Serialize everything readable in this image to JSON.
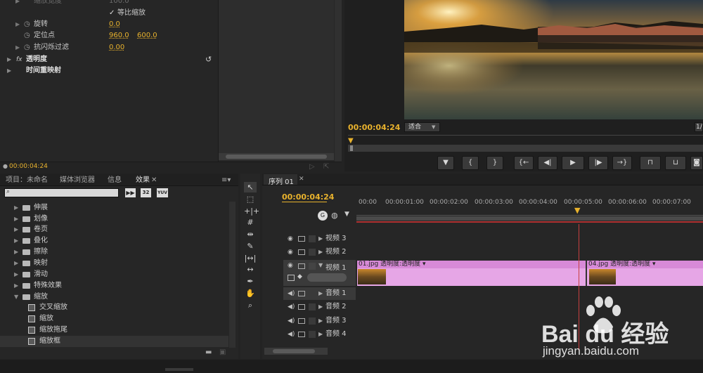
{
  "effect_controls": {
    "rows": [
      {
        "label": "缩放宽度",
        "value": "100.0"
      },
      {
        "label": "等比缩放",
        "checked": true
      },
      {
        "label": "旋转",
        "value": "0.0"
      },
      {
        "label": "定位点",
        "value": "960.0",
        "value2": "600.0"
      },
      {
        "label": "抗闪烁过滤",
        "value": "0.00"
      }
    ],
    "sections": [
      {
        "fx": "fx",
        "label": "透明度"
      },
      {
        "label": "时间重映射"
      }
    ],
    "timecode": "00:00:04:24"
  },
  "program": {
    "timecode": "00:00:04:24",
    "fit_label": "适合",
    "right_label": "1/"
  },
  "project": {
    "tabs": [
      "项目：未命名",
      "媒体浏览器",
      "信息",
      "效果"
    ],
    "search_placeholder": "",
    "badges": [
      "32",
      "YUV"
    ],
    "folders": [
      "伸展",
      "划像",
      "卷页",
      "叠化",
      "擦除",
      "映射",
      "滑动",
      "特殊效果",
      "缩放"
    ],
    "effects": [
      "交叉缩放",
      "缩放",
      "缩放拖尾",
      "缩放框"
    ]
  },
  "timeline": {
    "tab": "序列 01",
    "timecode": "00:00:04:24",
    "ruler": [
      "00:00",
      "00:00:01:00",
      "00:00:02:00",
      "00:00:03:00",
      "00:00:04:00",
      "00:00:05:00",
      "00:00:06:00",
      "00:00:07:00"
    ],
    "video_tracks": [
      "视频 3",
      "视频 2",
      "视频 1"
    ],
    "audio_tracks": [
      "音频 1",
      "音频 2",
      "音频 3",
      "音频 4"
    ],
    "clip1": {
      "name": "01.jpg",
      "effect": "透明度:透明度"
    },
    "clip2": {
      "name": "04.jpg",
      "effect": "透明度:透明度"
    }
  },
  "watermark": {
    "logo": "Bai du 经验",
    "url": "jingyan.baidu.com"
  }
}
